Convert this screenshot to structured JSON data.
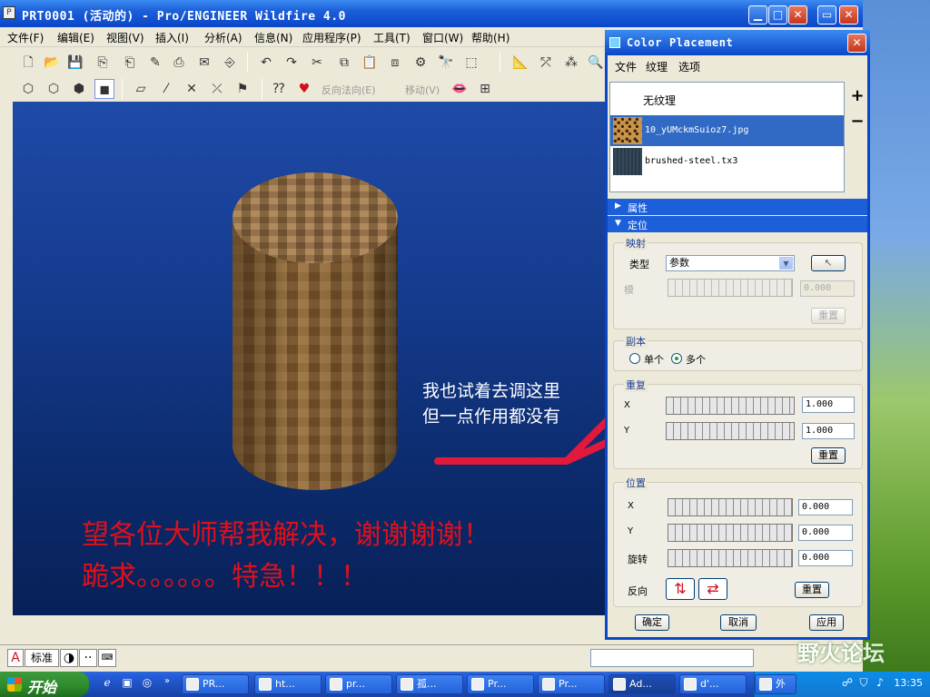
{
  "window": {
    "title": "PRT0001 (活动的) - Pro/ENGINEER Wildfire 4.0",
    "minimize": "▁",
    "maximize": "□",
    "close": "✕"
  },
  "menubar": [
    "文件(F)",
    "编辑(E)",
    "视图(V)",
    "插入(I)",
    "分析(A)",
    "信息(N)",
    "应用程序(P)",
    "工具(T)",
    "窗口(W)",
    "帮助(H)"
  ],
  "toolbar": {
    "reverse_normal": "反向法向(E)",
    "move": "移动(V)"
  },
  "viewport": {
    "note_lines": [
      "我也试着去调这里",
      "但一点作用都没有"
    ],
    "plea_lines": [
      "望各位大师帮我解决，谢谢谢谢！",
      "跪求。。。。。。特急！！！"
    ],
    "colors": {
      "arrow": "#e3193b",
      "plea": "#e0101a"
    }
  },
  "statusbar": {
    "btn_a": "A",
    "btn_std": "标准",
    "btn_moon": "◑",
    "btn_dots": "··"
  },
  "dialog": {
    "title": "Color Placement",
    "close": "✕",
    "menu": [
      "文件",
      "纹理",
      "选项"
    ],
    "textures": [
      {
        "label": "无纹理",
        "selected": false
      },
      {
        "label": "10_yUMckmSuioz7.jpg",
        "selected": true
      },
      {
        "label": "brushed-steel.tx3",
        "selected": false
      }
    ],
    "add": "+",
    "remove": "−",
    "sections": {
      "properties": "属性",
      "placement": "定位"
    },
    "mapping": {
      "title": "映射",
      "type_label": "类型",
      "type_value": "参数",
      "model_label": "模",
      "model_value": "0.000",
      "reset": "重置"
    },
    "copies": {
      "title": "副本",
      "single": "单个",
      "multiple": "多个",
      "selected": "multiple"
    },
    "repeat": {
      "title": "重复",
      "x_label": "X",
      "y_label": "Y",
      "x_value": "1.000",
      "y_value": "1.000",
      "reset": "重置"
    },
    "position": {
      "title": "位置",
      "x_label": "X",
      "y_label": "Y",
      "rot_label": "旋转",
      "x_value": "0.000",
      "y_value": "0.000",
      "rot_value": "0.000",
      "flip_label": "反向",
      "reset": "重置"
    },
    "buttons": {
      "ok": "确定",
      "cancel": "取消",
      "apply": "应用"
    }
  },
  "taskbar": {
    "start": "开始",
    "tasks": [
      "PR...",
      "ht...",
      "pr...",
      "孤...",
      "Pr...",
      "Pr...",
      "Ad...",
      "d'...",
      "外"
    ],
    "clock": "13:35",
    "watermark": "野火论坛"
  }
}
